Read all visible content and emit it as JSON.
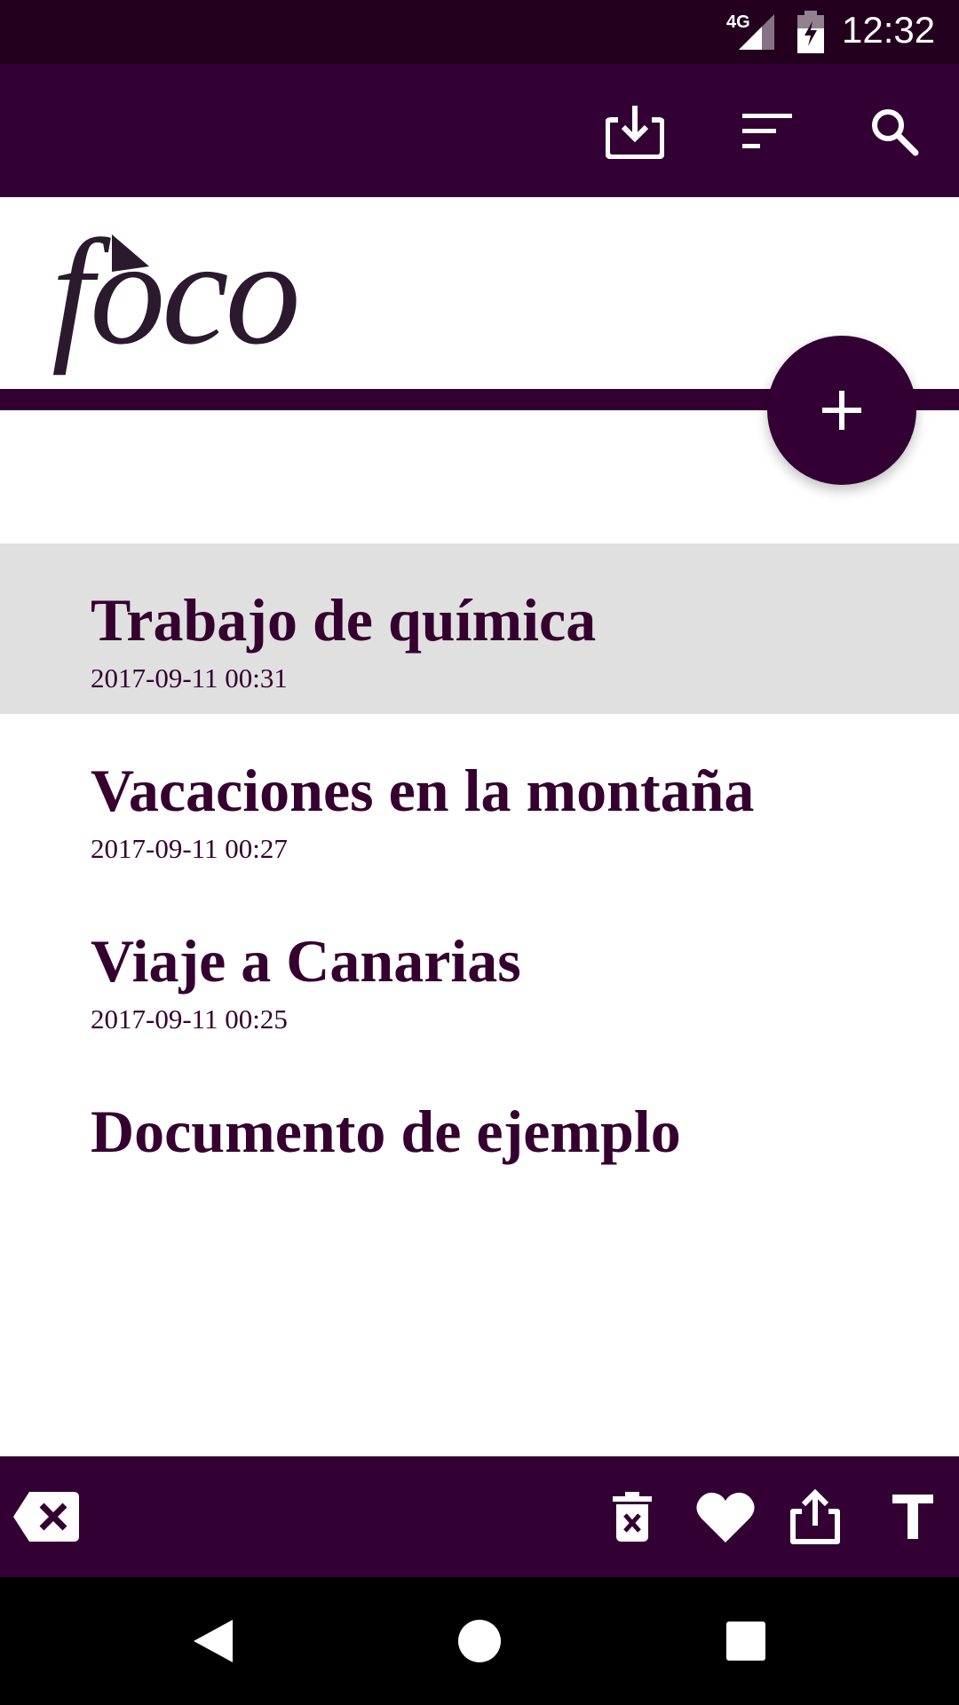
{
  "status_bar": {
    "network": "4G",
    "time": "12:32",
    "icons": [
      "signal-icon",
      "battery-charging-icon"
    ]
  },
  "app_bar": {
    "actions": [
      {
        "name": "import-button",
        "icon": "download-tray-icon"
      },
      {
        "name": "sort-button",
        "icon": "sort-icon"
      },
      {
        "name": "search-button",
        "icon": "search-icon"
      }
    ]
  },
  "logo": {
    "text": "foco"
  },
  "fab": {
    "icon": "plus-icon"
  },
  "documents": [
    {
      "title": "Trabajo de química",
      "date": "2017-09-11 00:31",
      "selected": true
    },
    {
      "title": "Vacaciones en la montaña",
      "date": "2017-09-11 00:27",
      "selected": false
    },
    {
      "title": "Viaje a Canarias",
      "date": "2017-09-11 00:25",
      "selected": false
    },
    {
      "title": "Documento de ejemplo",
      "date": "",
      "selected": false
    }
  ],
  "bottom_bar": {
    "actions": [
      {
        "name": "clear-selection-button",
        "icon": "backspace-x-icon"
      },
      {
        "name": "delete-button",
        "icon": "trash-icon"
      },
      {
        "name": "favorite-button",
        "icon": "heart-icon"
      },
      {
        "name": "share-button",
        "icon": "share-upload-icon"
      },
      {
        "name": "rename-button",
        "icon": "text-t-icon"
      }
    ]
  },
  "nav_bar": {
    "buttons": [
      "back-icon",
      "home-icon",
      "recents-icon"
    ]
  },
  "colors": {
    "primary": "#330033",
    "status_bar": "#24001f",
    "text": "#35002f",
    "selected_row": "#e0e0e0",
    "logo": "#2b1a2e"
  }
}
